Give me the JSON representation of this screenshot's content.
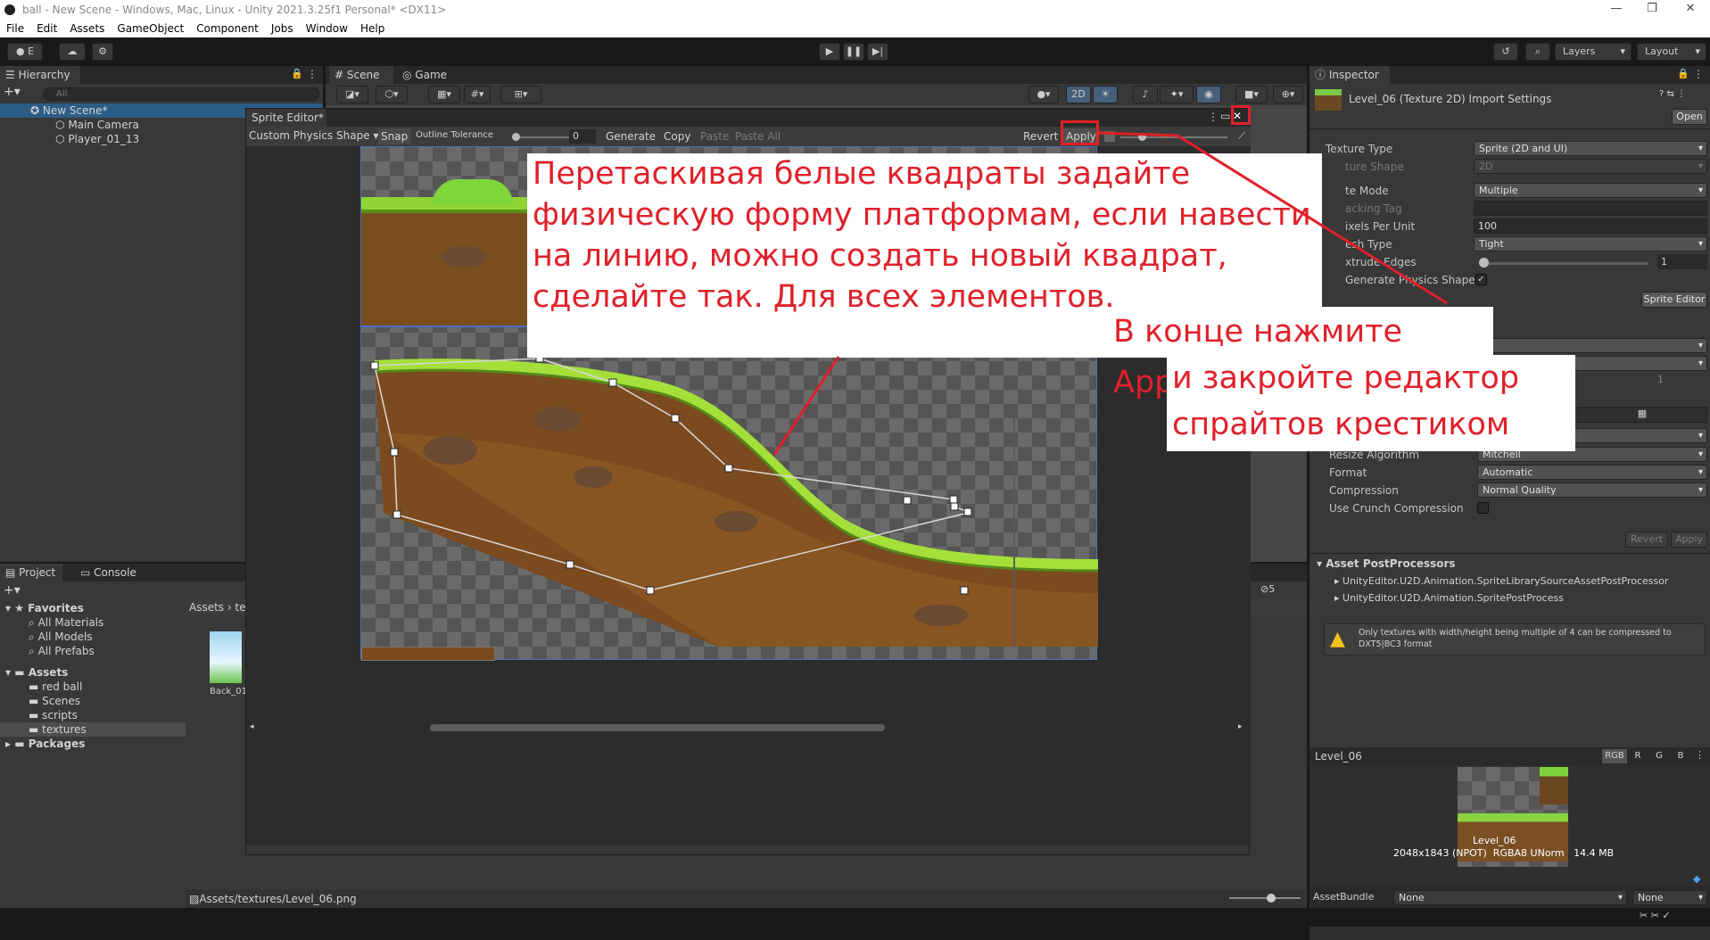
{
  "window": {
    "title": "ball - New Scene - Windows, Mac, Linux - Unity 2021.3.25f1 Personal* <DX11>"
  },
  "menu": [
    "File",
    "Edit",
    "Assets",
    "GameObject",
    "Component",
    "Jobs",
    "Window",
    "Help"
  ],
  "toolbar": {
    "account": "E",
    "layers": "Layers",
    "layout": "Layout"
  },
  "hierarchy": {
    "tab": "Hierarchy",
    "search_placeholder": "All",
    "scene": "New Scene*",
    "items": [
      "Main Camera",
      "Player_01_13"
    ]
  },
  "scene_tabs": {
    "scene": "Scene",
    "game": "Game",
    "mode_2d": "2D"
  },
  "project": {
    "tab_project": "Project",
    "tab_console": "Console",
    "favorites_label": "Favorites",
    "favorites": [
      "All Materials",
      "All Models",
      "All Prefabs"
    ],
    "assets_label": "Assets",
    "asset_folders": [
      "red ball",
      "Scenes",
      "scripts",
      "textures"
    ],
    "packages_label": "Packages",
    "breadcrumb": "Assets",
    "breadcrumb_next": "te",
    "thumb_label": "Back_01",
    "status_path": "Assets/textures/Level_06.png",
    "hidden_count": "5"
  },
  "sprite_editor": {
    "title": "Sprite Editor*",
    "mode": "Custom Physics Shape",
    "snap": "Snap",
    "outline_tolerance_label": "Outline Tolerance",
    "outline_tolerance_value": "0",
    "generate": "Generate",
    "copy": "Copy",
    "paste": "Paste",
    "paste_all": "Paste All",
    "revert": "Revert",
    "apply": "Apply"
  },
  "annotation": {
    "lines": [
      "Перетаскивая белые квадраты задайте",
      "физическую форму платформам, если навести",
      "на линию, можно создать новый квадрат,",
      "сделайте так. Для всех элементов."
    ],
    "line_right": "В конце нажмите Apply",
    "lines_bottom": [
      "и закройте редактор",
      "спрайтов крестиком"
    ]
  },
  "inspector": {
    "tab": "Inspector",
    "title": "Level_06 (Texture 2D) Import Settings",
    "open": "Open",
    "fields": [
      {
        "label": "Texture Type",
        "value": "Sprite (2D and UI)"
      },
      {
        "label": "ture Shape",
        "value": "2D"
      },
      {
        "label": "te Mode",
        "value": "Multiple"
      },
      {
        "label": "acking Tag",
        "value": ""
      },
      {
        "label": "ixels Per Unit",
        "value": "100"
      },
      {
        "label": "esh Type",
        "value": "Tight"
      },
      {
        "label": "xtrude Edges",
        "value": "1"
      },
      {
        "label": "Generate Physics Shape",
        "value": "✓"
      }
    ],
    "sprite_editor_button": "Sprite Editor",
    "hidden_value": "1",
    "resize_label": "Resize Algorithm",
    "resize_value": "Mitchell",
    "format_label": "Format",
    "format_value": "Automatic",
    "compression_label": "Compression",
    "compression_value": "Normal Quality",
    "crunch_label": "Use Crunch Compression",
    "revert": "Revert",
    "apply": "Apply",
    "postprocessors_title": "Asset PostProcessors",
    "postprocessors": [
      "UnityEditor.U2D.Animation.SpriteLibrarySourceAssetPostProcessor",
      "UnityEditor.U2D.Animation.SpritePostProcess"
    ],
    "warning": "Only textures with width/height being multiple of 4 can be compressed to DXT5|BC3 format",
    "preview": {
      "name": "Level_06",
      "channels": [
        "RGB",
        "R",
        "G",
        "B"
      ],
      "thumb_label": "Level_06",
      "info": "2048x1843 (NPOT)  RGBA8 UNorm   14.4 MB"
    },
    "asset_bundle_label": "AssetBundle",
    "asset_bundle_value": "None",
    "asset_bundle_variant": "None"
  },
  "colors": {
    "annotation_red": "#e0202a",
    "editor_bg": "#383838",
    "dark_bg": "#191919"
  }
}
